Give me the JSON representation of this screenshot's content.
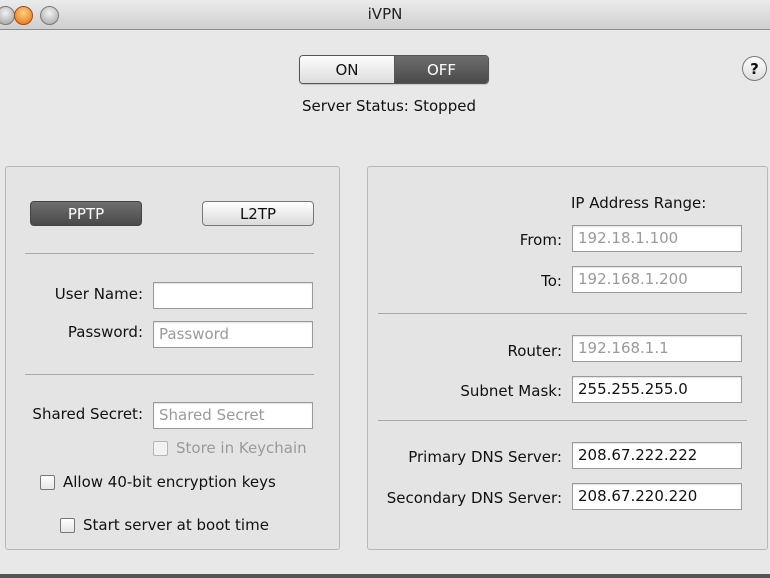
{
  "window": {
    "title": "iVPN"
  },
  "power": {
    "on_label": "ON",
    "off_label": "OFF",
    "selected": "OFF"
  },
  "server_status": {
    "label": "Server Status:",
    "value": "Stopped"
  },
  "help": {
    "label": "?"
  },
  "protocol": {
    "pptp_label": "PPTP",
    "l2tp_label": "L2TP",
    "selected": "PPTP"
  },
  "credentials": {
    "username_label": "User Name:",
    "username_value": "",
    "password_label": "Password:",
    "password_placeholder": "Password"
  },
  "shared_secret": {
    "label": "Shared Secret:",
    "placeholder": "Shared Secret",
    "keychain_label": "Store in Keychain",
    "keychain_checked": false
  },
  "options": {
    "allow_40bit_label": "Allow 40-bit encryption keys",
    "allow_40bit_checked": false,
    "boot_label": "Start server at boot time",
    "boot_checked": false
  },
  "ip_range": {
    "heading": "IP Address Range:",
    "from_label": "From:",
    "from_placeholder": "192.18.1.100",
    "to_label": "To:",
    "to_placeholder": "192.168.1.200"
  },
  "network": {
    "router_label": "Router:",
    "router_placeholder": "192.168.1.1",
    "subnet_label": "Subnet Mask:",
    "subnet_value": "255.255.255.0"
  },
  "dns": {
    "primary_label": "Primary DNS Server:",
    "primary_value": "208.67.222.222",
    "secondary_label": "Secondary DNS Server:",
    "secondary_value": "208.67.220.220"
  }
}
